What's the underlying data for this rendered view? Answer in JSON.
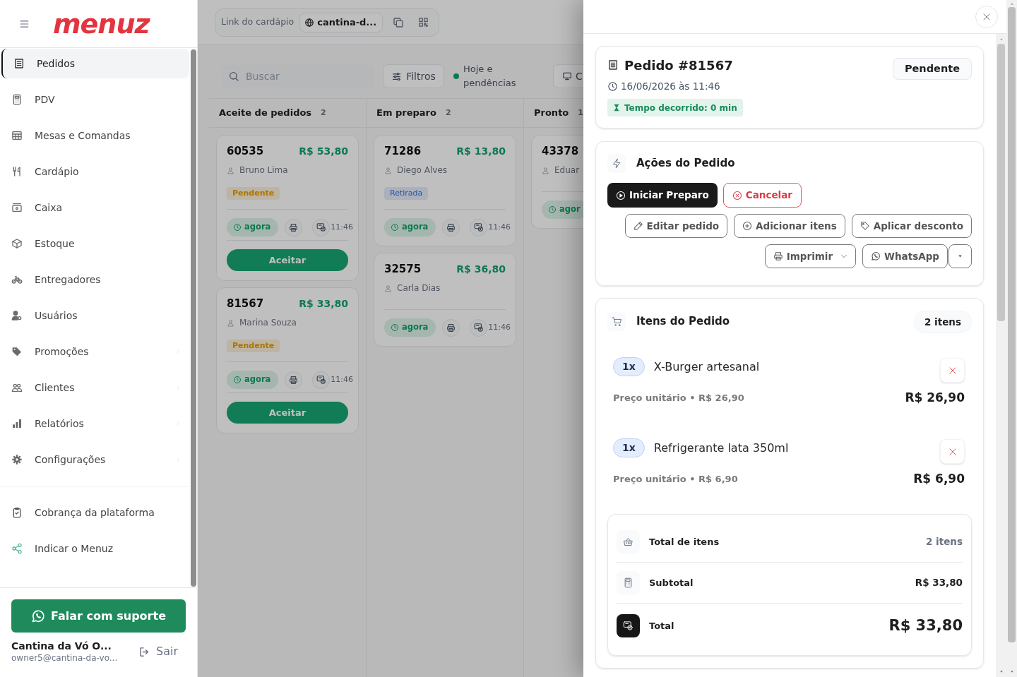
{
  "sidebar": {
    "logo": "menuz",
    "nav": [
      {
        "label": "Pedidos",
        "selected": true,
        "expandable": false
      },
      {
        "label": "PDV",
        "selected": false,
        "expandable": false
      },
      {
        "label": "Mesas e Comandas",
        "selected": false,
        "expandable": false
      },
      {
        "label": "Cardápio",
        "selected": false,
        "expandable": false
      },
      {
        "label": "Caixa",
        "selected": false,
        "expandable": false
      },
      {
        "label": "Estoque",
        "selected": false,
        "expandable": false
      },
      {
        "label": "Entregadores",
        "selected": false,
        "expandable": false
      },
      {
        "label": "Usuários",
        "selected": false,
        "expandable": false
      },
      {
        "label": "Promoções",
        "selected": false,
        "expandable": true
      },
      {
        "label": "Clientes",
        "selected": false,
        "expandable": true
      },
      {
        "label": "Relatórios",
        "selected": false,
        "expandable": true
      },
      {
        "label": "Configurações",
        "selected": false,
        "expandable": true
      }
    ],
    "extra_nav": [
      {
        "label": "Cobrança da plataforma",
        "selected": false
      },
      {
        "label": "Indicar o Menuz",
        "selected": false
      }
    ],
    "support_button": "Falar com suporte",
    "account": {
      "name": "Cantina da Vó O...",
      "email": "owner5@cantina-da-vo...",
      "logout": "Sair"
    }
  },
  "topbar": {
    "menu_link": {
      "label": "Link do cardápio",
      "value": "cantina-d..."
    }
  },
  "toolbar": {
    "search": {
      "placeholder": "Buscar"
    },
    "filters": "Filtros",
    "period": "Hoje e pendências",
    "view_button": "C"
  },
  "board": {
    "columns": [
      {
        "title": "Aceite de pedidos",
        "count": "2",
        "orders": [
          {
            "number": "60535",
            "total": "R$ 53,80",
            "customer": "Bruno Lima",
            "badge": {
              "label": "Pendente",
              "kind": "pending"
            },
            "elapsed": "agora",
            "time": "11:46",
            "action": "Aceitar"
          },
          {
            "number": "81567",
            "total": "R$ 33,80",
            "customer": "Marina Souza",
            "badge": {
              "label": "Pendente",
              "kind": "pending"
            },
            "elapsed": "agora",
            "time": "11:46",
            "action": "Aceitar"
          }
        ]
      },
      {
        "title": "Em preparo",
        "count": "2",
        "orders": [
          {
            "number": "71286",
            "total": "R$ 13,80",
            "customer": "Diego Alves",
            "badge": {
              "label": "Retirada",
              "kind": "pickup"
            },
            "elapsed": "agora",
            "time": "11:46"
          },
          {
            "number": "32575",
            "total": "R$ 36,80",
            "customer": "Carla Dias",
            "elapsed": "agora",
            "time": "11:46"
          }
        ]
      },
      {
        "title": "Pronto",
        "count": "1",
        "orders": [
          {
            "number": "43378",
            "customer": "Eduar",
            "elapsed": "agor"
          }
        ]
      }
    ]
  },
  "order_panel": {
    "title": "Pedido #81567",
    "status": "Pendente",
    "date": "16/06/2026 às 11:46",
    "elapsed": "Tempo decorrido: 0 min",
    "actions": {
      "title": "Ações do Pedido",
      "main_buttons": [
        {
          "label": "Iniciar Preparo",
          "kind": "start"
        },
        {
          "label": "Cancelar",
          "kind": "cancel"
        }
      ],
      "buttons": [
        {
          "label": "Editar pedido",
          "kind": "edit"
        },
        {
          "label": "Adicionar itens",
          "kind": "add"
        },
        {
          "label": "Aplicar desconto",
          "kind": "discount"
        },
        {
          "label": "Imprimir",
          "kind": "print"
        },
        {
          "label": "WhatsApp",
          "kind": "whatsapp"
        }
      ]
    },
    "items": {
      "title": "Itens do Pedido",
      "count": "2 itens",
      "list": [
        {
          "qty": "1x",
          "name": "X-Burger artesanal",
          "unit_price": "Preço unitário • R$ 26,90",
          "total": "R$ 26,90"
        },
        {
          "qty": "1x",
          "name": "Refrigerante lata 350ml",
          "unit_price": "Preço unitário • R$ 6,90",
          "total": "R$ 6,90"
        }
      ],
      "summary": [
        {
          "kind": "count",
          "label": "Total de itens",
          "value": "2 itens"
        },
        {
          "kind": "subtotal",
          "label": "Subtotal",
          "value": "R$ 33,80"
        },
        {
          "kind": "total",
          "label": "Total",
          "value": "R$ 33,80"
        }
      ]
    }
  }
}
